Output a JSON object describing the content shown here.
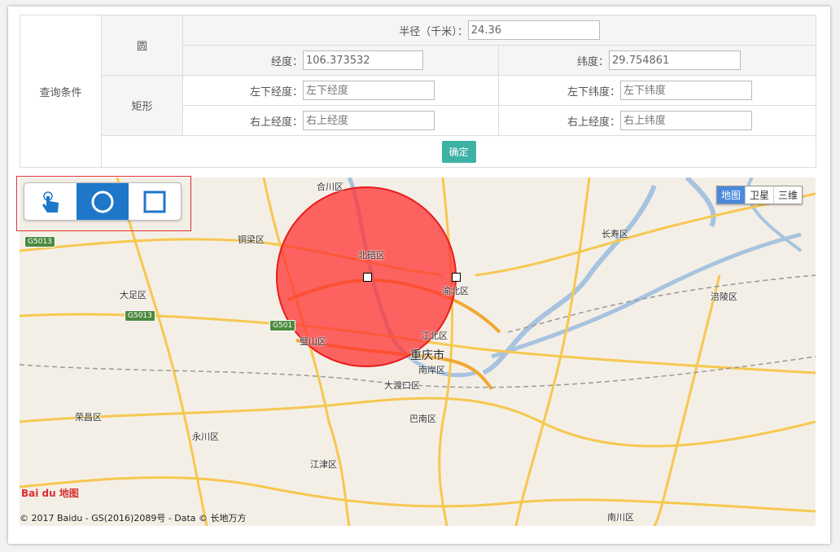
{
  "query": {
    "section_label": "查询条件",
    "circle_label": "圆",
    "rect_label": "矩形",
    "radius_label": "半径（千米）：",
    "radius_value": "24.36",
    "lng_label": "经度：",
    "lng_value": "106.373532",
    "lat_label": "纬度：",
    "lat_value": "29.754861",
    "bl_lng_label": "左下经度：",
    "bl_lng_placeholder": "左下经度",
    "bl_lat_label": "左下纬度：",
    "bl_lat_placeholder": "左下纬度",
    "tr_lng_label": "右上经度：",
    "tr_lng_placeholder": "右上经度",
    "tr_lat_label": "右上经度：",
    "tr_lat_placeholder": "右上纬度",
    "confirm_label": "确定"
  },
  "map": {
    "types": [
      "地图",
      "卫星",
      "三维"
    ],
    "active_type": "地图",
    "tools": [
      "hand-pointer-icon",
      "circle-tool-icon",
      "rectangle-tool-icon"
    ],
    "active_tool": "circle-tool-icon",
    "circle_color": "#ff3333",
    "labels": [
      "合川区",
      "铜梁区",
      "北碚区",
      "大足区",
      "渝北区",
      "璧山区",
      "江北区",
      "重庆市",
      "南岸区",
      "大渡口区",
      "荣昌区",
      "永川区",
      "巴南区",
      "江津区",
      "长寿区",
      "涪陵区",
      "南川区"
    ],
    "shields": [
      "G5013",
      "G5013",
      "G501"
    ],
    "logo": "Bai du 地图",
    "copyright": "© 2017 Baidu - GS(2016)2089号 - Data © 长地万方"
  }
}
